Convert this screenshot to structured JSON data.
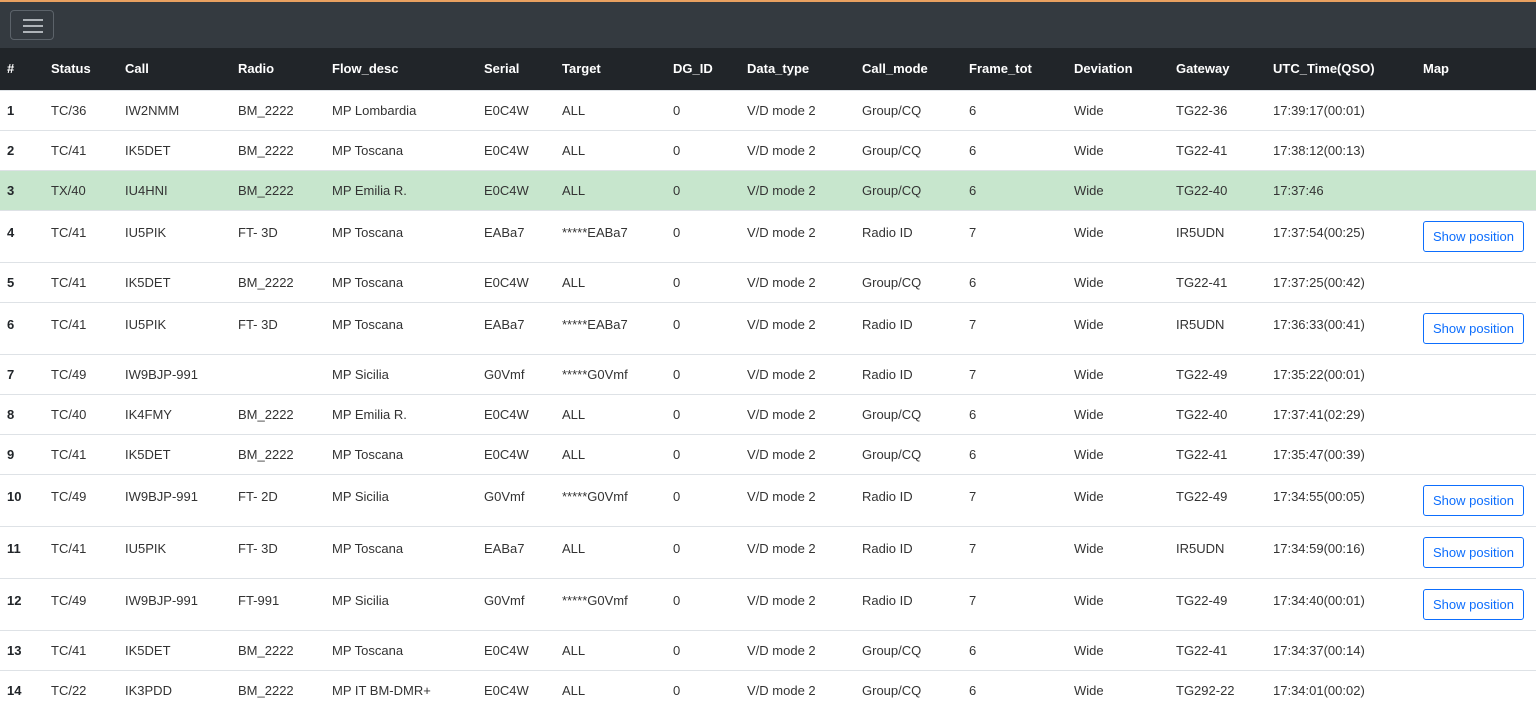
{
  "header": {
    "menu_icon": "hamburger-menu-icon",
    "accent_color": "#e8a060"
  },
  "table": {
    "columns": [
      "#",
      "Status",
      "Call",
      "Radio",
      "Flow_desc",
      "Serial",
      "Target",
      "DG_ID",
      "Data_type",
      "Call_mode",
      "Frame_tot",
      "Deviation",
      "Gateway",
      "UTC_Time(QSO)",
      "Map"
    ],
    "show_position_label": "Show position",
    "highlight_color": "#c7e6cd",
    "rows": [
      {
        "num": "1",
        "status": "TC/36",
        "call": "IW2NMM",
        "radio": "BM_2222",
        "flow": "MP Lombardia",
        "serial": "E0C4W",
        "target": "ALL",
        "dgid": "0",
        "dtype": "V/D mode 2",
        "cmode": "Group/CQ",
        "frames": "6",
        "dev": "Wide",
        "gw": "TG22-36",
        "utc": "17:39:17(00:01)",
        "map": false,
        "highlight": false
      },
      {
        "num": "2",
        "status": "TC/41",
        "call": "IK5DET",
        "radio": "BM_2222",
        "flow": "MP Toscana",
        "serial": "E0C4W",
        "target": "ALL",
        "dgid": "0",
        "dtype": "V/D mode 2",
        "cmode": "Group/CQ",
        "frames": "6",
        "dev": "Wide",
        "gw": "TG22-41",
        "utc": "17:38:12(00:13)",
        "map": false,
        "highlight": false
      },
      {
        "num": "3",
        "status": "TX/40",
        "call": "IU4HNI",
        "radio": "BM_2222",
        "flow": "MP Emilia R.",
        "serial": "E0C4W",
        "target": "ALL",
        "dgid": "0",
        "dtype": "V/D mode 2",
        "cmode": "Group/CQ",
        "frames": "6",
        "dev": "Wide",
        "gw": "TG22-40",
        "utc": "17:37:46",
        "map": false,
        "highlight": true
      },
      {
        "num": "4",
        "status": "TC/41",
        "call": "IU5PIK",
        "radio": "FT- 3D",
        "flow": "MP Toscana",
        "serial": "EABa7",
        "target": "*****EABa7",
        "dgid": "0",
        "dtype": "V/D mode 2",
        "cmode": "Radio ID",
        "frames": "7",
        "dev": "Wide",
        "gw": "IR5UDN",
        "utc": "17:37:54(00:25)",
        "map": true,
        "highlight": false
      },
      {
        "num": "5",
        "status": "TC/41",
        "call": "IK5DET",
        "radio": "BM_2222",
        "flow": "MP Toscana",
        "serial": "E0C4W",
        "target": "ALL",
        "dgid": "0",
        "dtype": "V/D mode 2",
        "cmode": "Group/CQ",
        "frames": "6",
        "dev": "Wide",
        "gw": "TG22-41",
        "utc": "17:37:25(00:42)",
        "map": false,
        "highlight": false
      },
      {
        "num": "6",
        "status": "TC/41",
        "call": "IU5PIK",
        "radio": "FT- 3D",
        "flow": "MP Toscana",
        "serial": "EABa7",
        "target": "*****EABa7",
        "dgid": "0",
        "dtype": "V/D mode 2",
        "cmode": "Radio ID",
        "frames": "7",
        "dev": "Wide",
        "gw": "IR5UDN",
        "utc": "17:36:33(00:41)",
        "map": true,
        "highlight": false
      },
      {
        "num": "7",
        "status": "TC/49",
        "call": "IW9BJP-991",
        "radio": "",
        "flow": "MP Sicilia",
        "serial": "G0Vmf",
        "target": "*****G0Vmf",
        "dgid": "0",
        "dtype": "V/D mode 2",
        "cmode": "Radio ID",
        "frames": "7",
        "dev": "Wide",
        "gw": "TG22-49",
        "utc": "17:35:22(00:01)",
        "map": false,
        "highlight": false
      },
      {
        "num": "8",
        "status": "TC/40",
        "call": "IK4FMY",
        "radio": "BM_2222",
        "flow": "MP Emilia R.",
        "serial": "E0C4W",
        "target": "ALL",
        "dgid": "0",
        "dtype": "V/D mode 2",
        "cmode": "Group/CQ",
        "frames": "6",
        "dev": "Wide",
        "gw": "TG22-40",
        "utc": "17:37:41(02:29)",
        "map": false,
        "highlight": false
      },
      {
        "num": "9",
        "status": "TC/41",
        "call": "IK5DET",
        "radio": "BM_2222",
        "flow": "MP Toscana",
        "serial": "E0C4W",
        "target": "ALL",
        "dgid": "0",
        "dtype": "V/D mode 2",
        "cmode": "Group/CQ",
        "frames": "6",
        "dev": "Wide",
        "gw": "TG22-41",
        "utc": "17:35:47(00:39)",
        "map": false,
        "highlight": false
      },
      {
        "num": "10",
        "status": "TC/49",
        "call": "IW9BJP-991",
        "radio": "FT- 2D",
        "flow": "MP Sicilia",
        "serial": "G0Vmf",
        "target": "*****G0Vmf",
        "dgid": "0",
        "dtype": "V/D mode 2",
        "cmode": "Radio ID",
        "frames": "7",
        "dev": "Wide",
        "gw": "TG22-49",
        "utc": "17:34:55(00:05)",
        "map": true,
        "highlight": false
      },
      {
        "num": "11",
        "status": "TC/41",
        "call": "IU5PIK",
        "radio": "FT- 3D",
        "flow": "MP Toscana",
        "serial": "EABa7",
        "target": "ALL",
        "dgid": "0",
        "dtype": "V/D mode 2",
        "cmode": "Radio ID",
        "frames": "7",
        "dev": "Wide",
        "gw": "IR5UDN",
        "utc": "17:34:59(00:16)",
        "map": true,
        "highlight": false
      },
      {
        "num": "12",
        "status": "TC/49",
        "call": "IW9BJP-991",
        "radio": "FT-991",
        "flow": "MP Sicilia",
        "serial": "G0Vmf",
        "target": "*****G0Vmf",
        "dgid": "0",
        "dtype": "V/D mode 2",
        "cmode": "Radio ID",
        "frames": "7",
        "dev": "Wide",
        "gw": "TG22-49",
        "utc": "17:34:40(00:01)",
        "map": true,
        "highlight": false
      },
      {
        "num": "13",
        "status": "TC/41",
        "call": "IK5DET",
        "radio": "BM_2222",
        "flow": "MP Toscana",
        "serial": "E0C4W",
        "target": "ALL",
        "dgid": "0",
        "dtype": "V/D mode 2",
        "cmode": "Group/CQ",
        "frames": "6",
        "dev": "Wide",
        "gw": "TG22-41",
        "utc": "17:34:37(00:14)",
        "map": false,
        "highlight": false
      },
      {
        "num": "14",
        "status": "TC/22",
        "call": "IK3PDD",
        "radio": "BM_2222",
        "flow": "MP IT BM-DMR+",
        "serial": "E0C4W",
        "target": "ALL",
        "dgid": "0",
        "dtype": "V/D mode 2",
        "cmode": "Group/CQ",
        "frames": "6",
        "dev": "Wide",
        "gw": "TG292-22",
        "utc": "17:34:01(00:02)",
        "map": false,
        "highlight": false
      }
    ]
  }
}
